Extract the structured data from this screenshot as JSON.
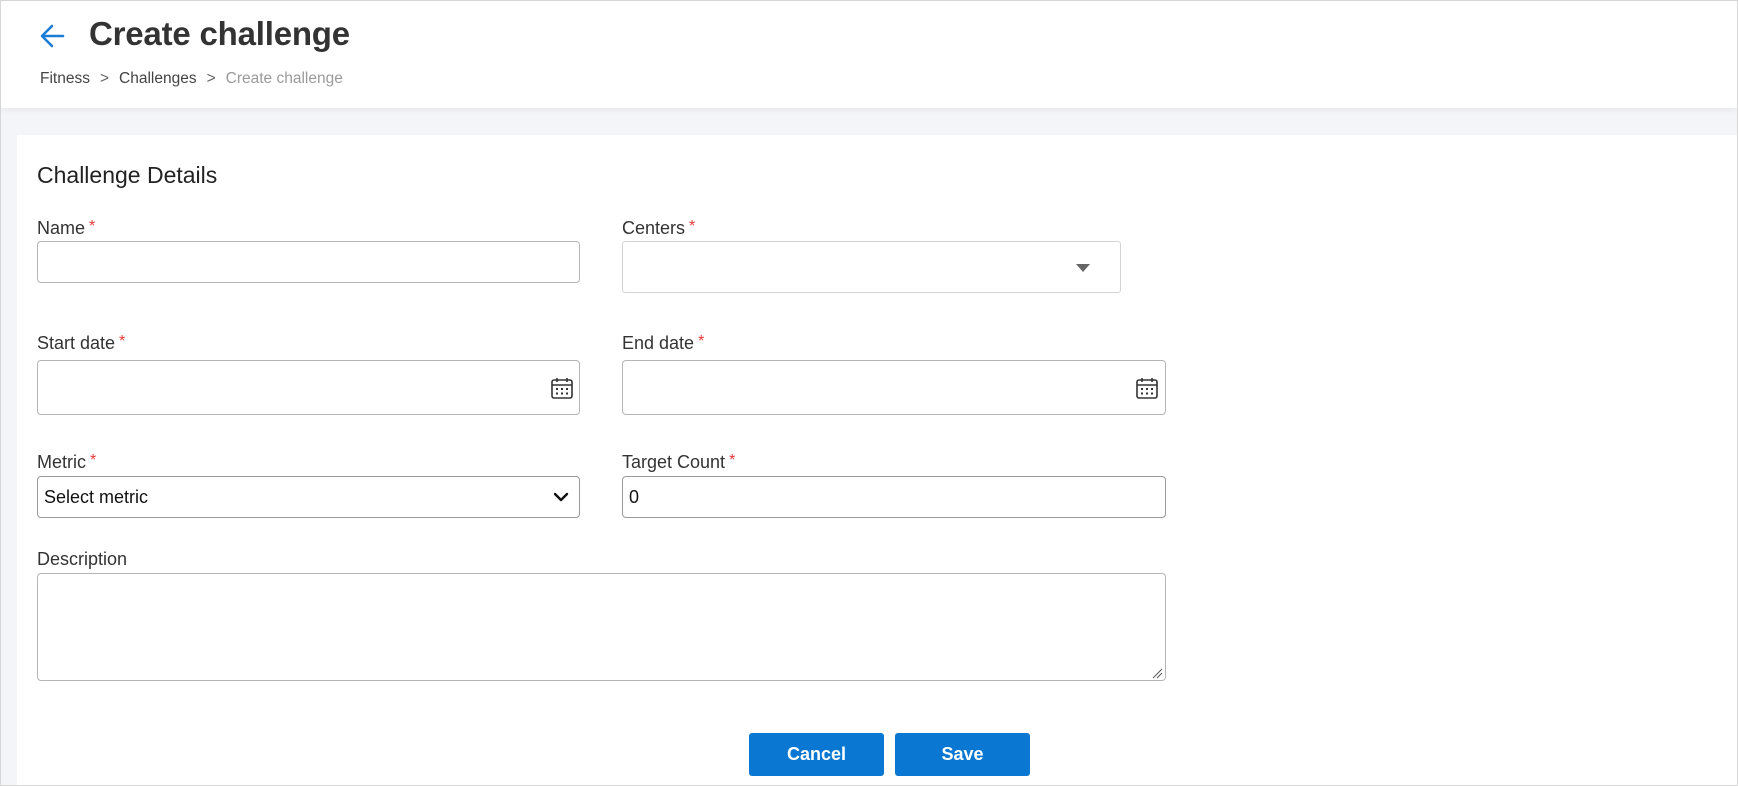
{
  "header": {
    "title": "Create challenge",
    "breadcrumb": [
      {
        "label": "Fitness"
      },
      {
        "label": "Challenges"
      },
      {
        "label": "Create challenge"
      }
    ],
    "breadcrumb_separator": ">"
  },
  "form": {
    "section_title": "Challenge Details",
    "required_marker": "*",
    "name": {
      "label": "Name",
      "value": ""
    },
    "centers": {
      "label": "Centers",
      "value": ""
    },
    "start_date": {
      "label": "Start date",
      "value": ""
    },
    "end_date": {
      "label": "End date",
      "value": ""
    },
    "metric": {
      "label": "Metric",
      "value": "Select metric"
    },
    "target_count": {
      "label": "Target Count",
      "value": "0"
    },
    "description": {
      "label": "Description",
      "value": ""
    }
  },
  "actions": {
    "cancel_label": "Cancel",
    "save_label": "Save"
  },
  "colors": {
    "accent": "#0a78d2",
    "required": "#e53935"
  }
}
